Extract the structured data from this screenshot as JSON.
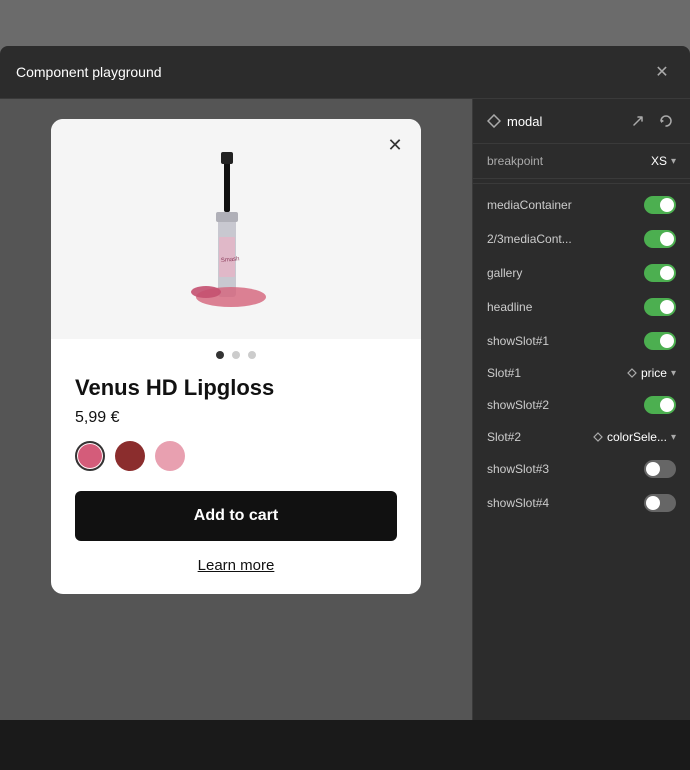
{
  "panel": {
    "title": "Component playground",
    "close_label": "✕"
  },
  "settings": {
    "title": "modal",
    "breakpoint_label": "breakpoint",
    "breakpoint_value": "XS",
    "refresh_icon": "↺",
    "export_icon": "↗",
    "rows": [
      {
        "id": "mediaContainer",
        "label": "mediaContainer",
        "type": "toggle",
        "value": true
      },
      {
        "id": "2/3mediaContainer",
        "label": "2/3mediaContа...",
        "type": "toggle",
        "value": true
      },
      {
        "id": "gallery",
        "label": "gallery",
        "type": "toggle",
        "value": true
      },
      {
        "id": "headline",
        "label": "headline",
        "type": "toggle",
        "value": true
      },
      {
        "id": "showSlot1",
        "label": "showSlot#1",
        "type": "toggle",
        "value": true
      },
      {
        "id": "slot1",
        "label": "Slot#1",
        "type": "slot",
        "diamond": true,
        "slot_value": "price"
      },
      {
        "id": "showSlot2",
        "label": "showSlot#2",
        "type": "toggle",
        "value": true
      },
      {
        "id": "slot2",
        "label": "Slot#2",
        "type": "slot",
        "diamond": true,
        "slot_value": "colorSele..."
      },
      {
        "id": "showSlot3",
        "label": "showSlot#3",
        "type": "toggle",
        "value": false
      },
      {
        "id": "showSlot4",
        "label": "showSlot#4",
        "type": "toggle",
        "value": false
      }
    ]
  },
  "modal": {
    "product_name": "Venus HD Lipgloss",
    "product_price": "5,99 €",
    "add_to_cart_label": "Add to cart",
    "learn_more_label": "Learn more",
    "dots": [
      {
        "active": true
      },
      {
        "active": false
      },
      {
        "active": false
      }
    ],
    "swatches": [
      {
        "color": "#d45c7a",
        "selected": true
      },
      {
        "color": "#8b2d2d",
        "selected": false
      },
      {
        "color": "#e8a0b0",
        "selected": false
      }
    ]
  }
}
